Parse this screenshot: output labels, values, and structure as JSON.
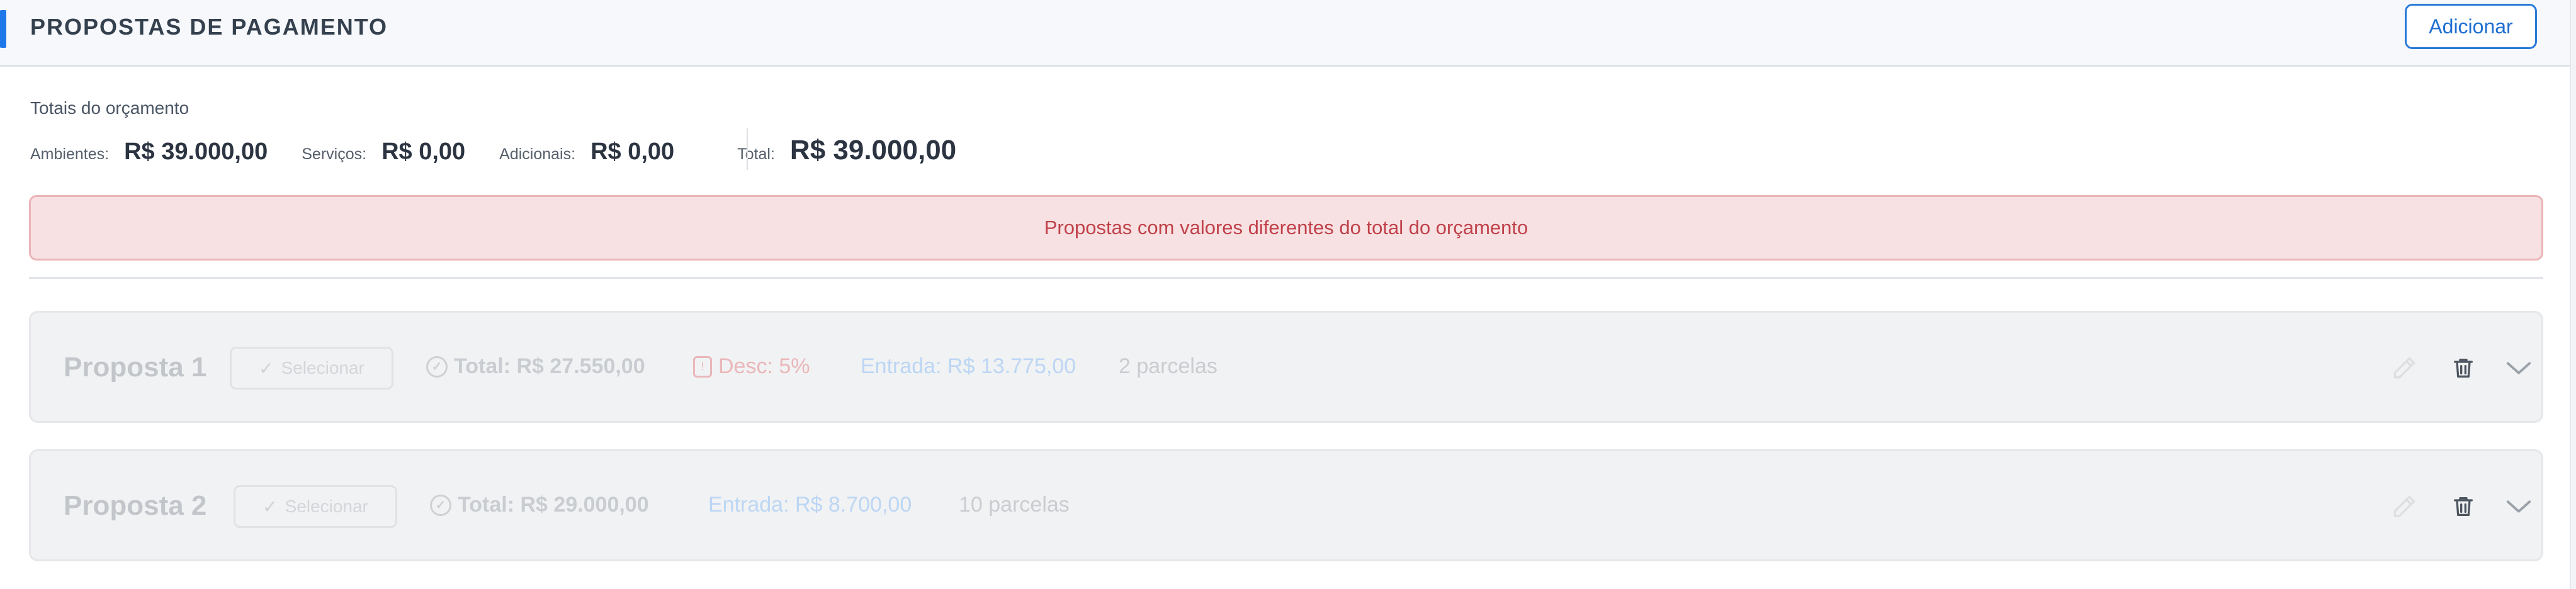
{
  "header": {
    "title": "PROPOSTAS DE PAGAMENTO",
    "add_label": "Adicionar"
  },
  "totals": {
    "caption": "Totais do orçamento",
    "ambientes_label": "Ambientes:",
    "ambientes_value": "R$ 39.000,00",
    "servicos_label": "Serviços:",
    "servicos_value": "R$ 0,00",
    "adicionais_label": "Adicionais:",
    "adicionais_value": "R$ 0,00",
    "total_label": "Total:",
    "total_value": "R$ 39.000,00"
  },
  "alert": {
    "message": "Propostas com valores diferentes do total do orçamento"
  },
  "proposals": [
    {
      "name": "Proposta 1",
      "select_label": "Selecionar",
      "total": "Total: R$ 27.550,00",
      "discount": "Desc: 5%",
      "entry": "Entrada: R$ 13.775,00",
      "installments": "2 parcelas"
    },
    {
      "name": "Proposta 2",
      "select_label": "Selecionar",
      "total": "Total: R$ 29.000,00",
      "entry": "Entrada: R$ 8.700,00",
      "installments": "10 parcelas"
    }
  ],
  "icons": {
    "edit": "pencil-icon",
    "delete": "trash-icon",
    "expand": "chevron-down-icon",
    "check": "check-icon",
    "discount": "price-tag-icon"
  },
  "colors": {
    "accent": "#1f78ea",
    "alert_bg": "#f8e1e2",
    "alert_text": "#c0414a",
    "card_bg": "#f1f2f3"
  }
}
